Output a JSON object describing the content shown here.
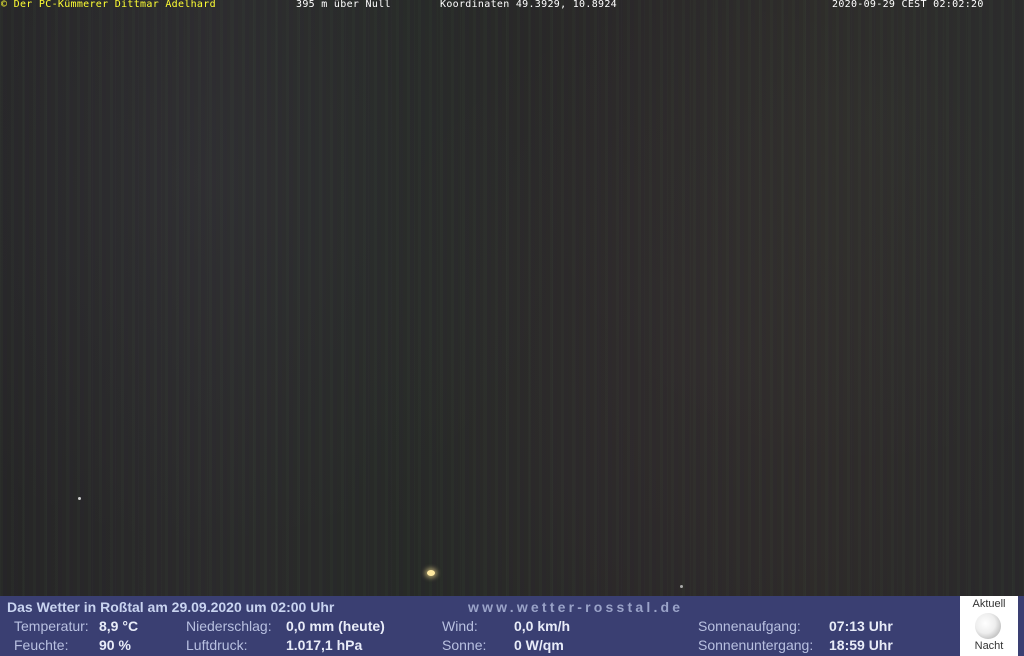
{
  "overlay": {
    "copyright": "© Der PC-Kümmerer Dittmar Adelhard",
    "altitude": "395 m über Null",
    "coordinates": "Koordinaten 49.3929, 10.8924",
    "timestamp": "2020-09-29 CEST 02:02:20"
  },
  "footer": {
    "title": "Das Wetter in Roßtal am 29.09.2020 um 02:00 Uhr",
    "site": "www.wetter-rosstal.de",
    "temperature_label": "Temperatur:",
    "temperature_value": "8,9 °C",
    "humidity_label": "Feuchte:",
    "humidity_value": "90 %",
    "precip_label": "Niederschlag:",
    "precip_value": "0,0 mm (heute)",
    "pressure_label": "Luftdruck:",
    "pressure_value": "1.017,1 hPa",
    "wind_label": "Wind:",
    "wind_value": "0,0 km/h",
    "sun_label": "Sonne:",
    "sun_value": "0 W/qm",
    "sunrise_label": "Sonnenaufgang:",
    "sunrise_value": "07:13 Uhr",
    "sunset_label": "Sonnenuntergang:",
    "sunset_value": "18:59 Uhr",
    "moon_top": "Aktuell",
    "moon_bottom": "Nacht",
    "moon_icon": "full-moon-icon"
  },
  "colors": {
    "footer_bg": "#3a3f72",
    "overlay_highlight": "#ffff33"
  }
}
